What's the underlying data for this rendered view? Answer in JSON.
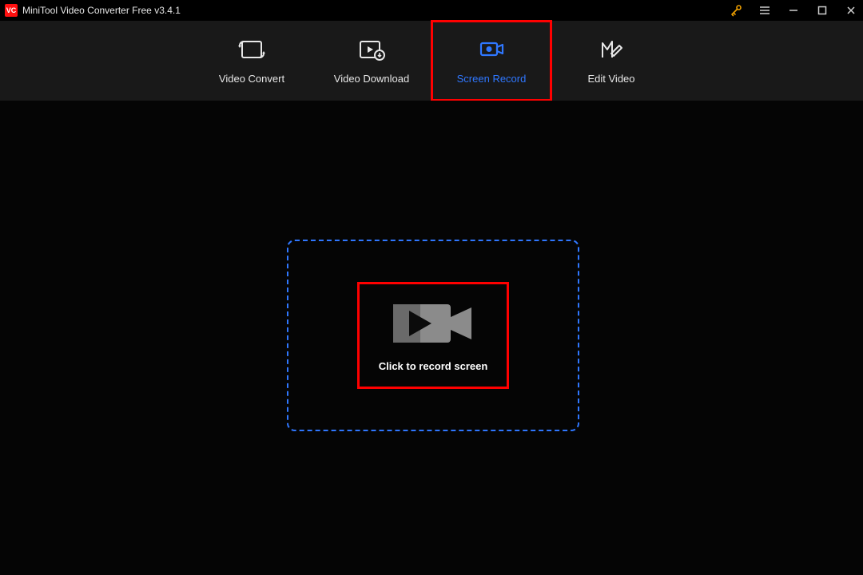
{
  "title": "MiniTool Video Converter Free v3.4.1",
  "tabs": {
    "convert": "Video Convert",
    "download": "Video Download",
    "record": "Screen Record",
    "edit": "Edit Video"
  },
  "main": {
    "record_label": "Click to record screen"
  },
  "colors": {
    "accent_blue": "#2f77ff",
    "highlight_red": "#ff0000"
  }
}
